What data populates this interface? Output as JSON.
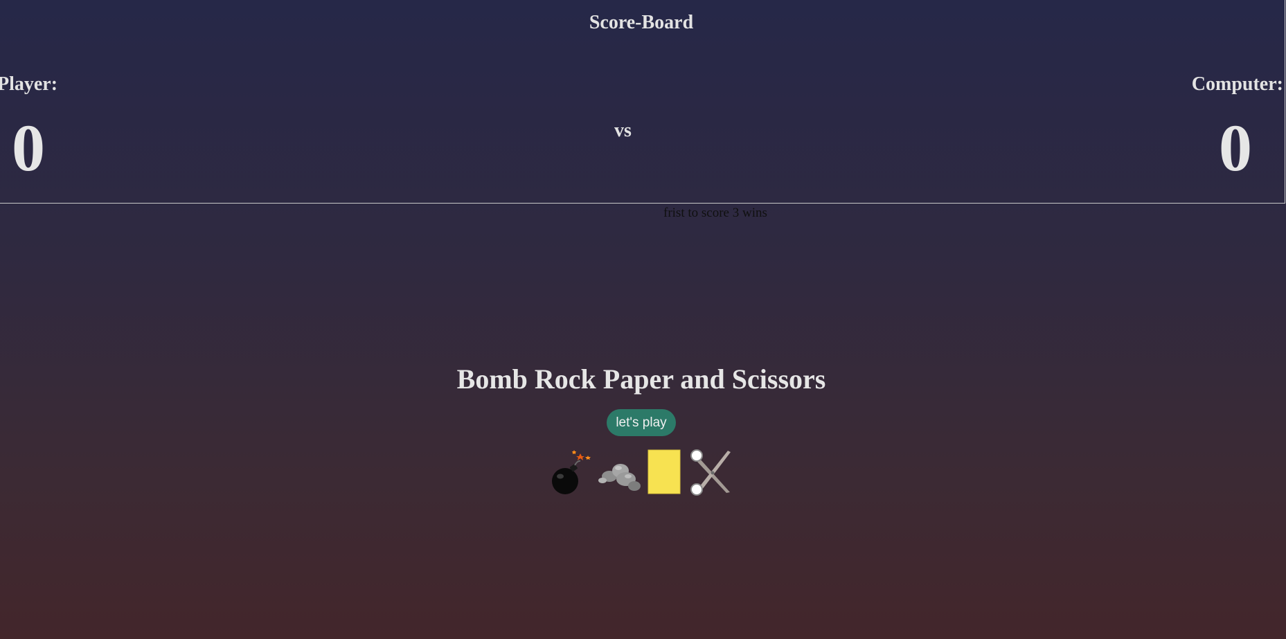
{
  "scoreboard": {
    "title": "Score-Board",
    "player_label": "Player:",
    "computer_label": "Computer:",
    "player_score": "0",
    "computer_score": "0",
    "vs": "vs"
  },
  "rule_text": "frist to score 3 wins",
  "game": {
    "title": "Bomb Rock Paper and Scissors",
    "play_button_label": "let's play",
    "choices": [
      {
        "name": "bomb",
        "icon": "bomb-icon"
      },
      {
        "name": "rock",
        "icon": "rock-icon"
      },
      {
        "name": "paper",
        "icon": "paper-icon"
      },
      {
        "name": "scissors",
        "icon": "scissors-icon"
      }
    ]
  },
  "colors": {
    "background_top": "#262848",
    "background_bottom": "#43262b",
    "button": "#2c7a68",
    "paper": "#f7e251",
    "text": "#e3e3e3"
  }
}
